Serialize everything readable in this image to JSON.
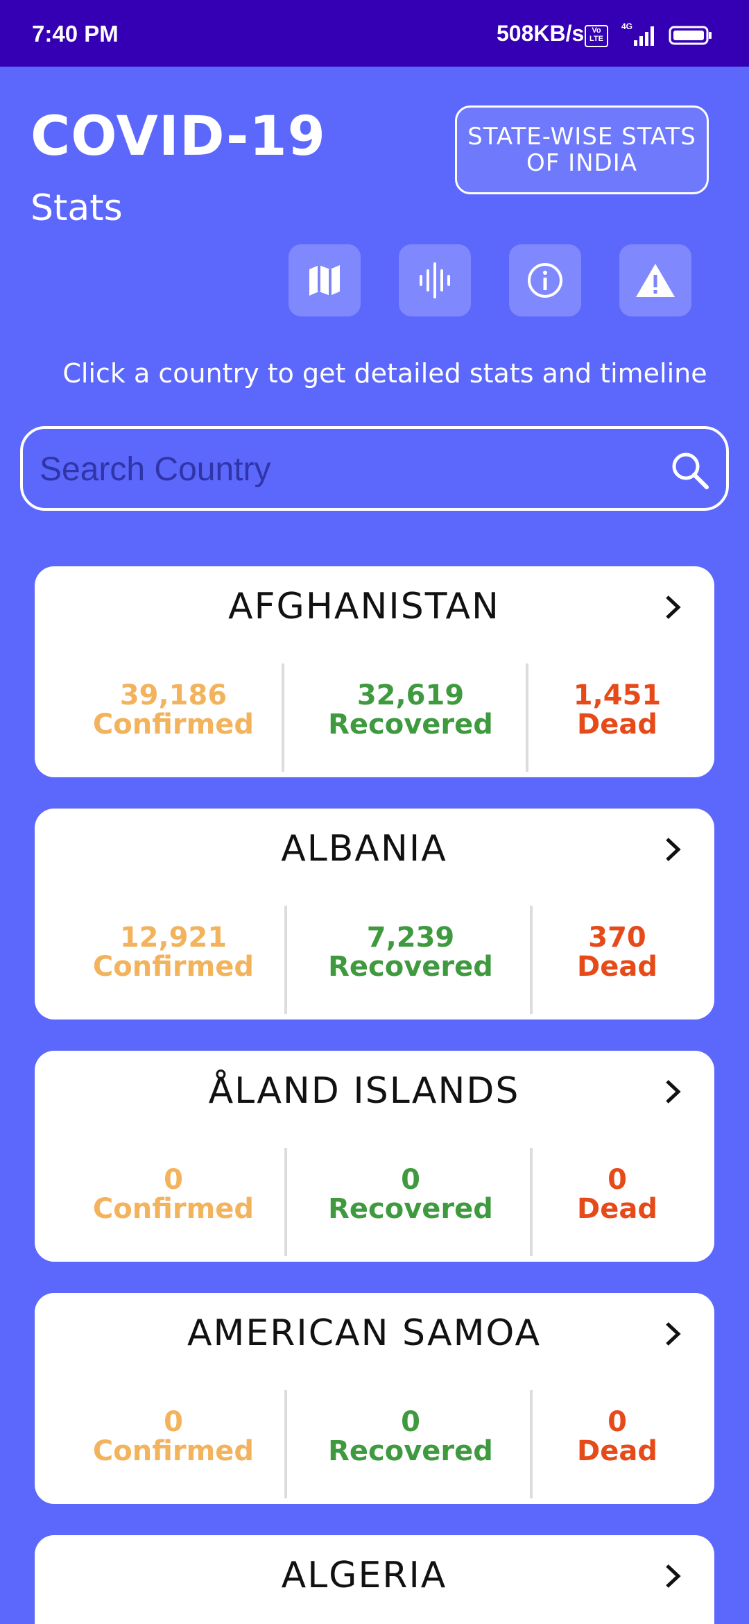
{
  "status_bar": {
    "time": "7:40 PM",
    "speed": "508KB/s",
    "volte": "Vo LTE",
    "network": "4G"
  },
  "header": {
    "title": "COVID-19",
    "subtitle": "Stats",
    "state_button": "STATE-WISE STATS OF INDIA",
    "icons": [
      "map-icon",
      "voice-icon",
      "info-icon",
      "warning-icon"
    ]
  },
  "hint": "Click a country to get detailed stats and timeline",
  "search": {
    "placeholder": "Search Country"
  },
  "labels": {
    "confirmed": "Confirmed",
    "recovered": "Recovered",
    "dead": "Dead"
  },
  "countries": [
    {
      "name": "AFGHANISTAN",
      "confirmed": "39,186",
      "recovered": "32,619",
      "dead": "1,451"
    },
    {
      "name": "ALBANIA",
      "confirmed": "12,921",
      "recovered": "7,239",
      "dead": "370"
    },
    {
      "name": "ÅLAND ISLANDS",
      "confirmed": "0",
      "recovered": "0",
      "dead": "0"
    },
    {
      "name": "AMERICAN SAMOA",
      "confirmed": "0",
      "recovered": "0",
      "dead": "0"
    },
    {
      "name": "ALGERIA"
    }
  ],
  "colors": {
    "background": "#5c67fc",
    "status_bar": "#3500b3",
    "confirmed": "#f2b35c",
    "recovered": "#3f9a3f",
    "dead": "#e64a19"
  }
}
